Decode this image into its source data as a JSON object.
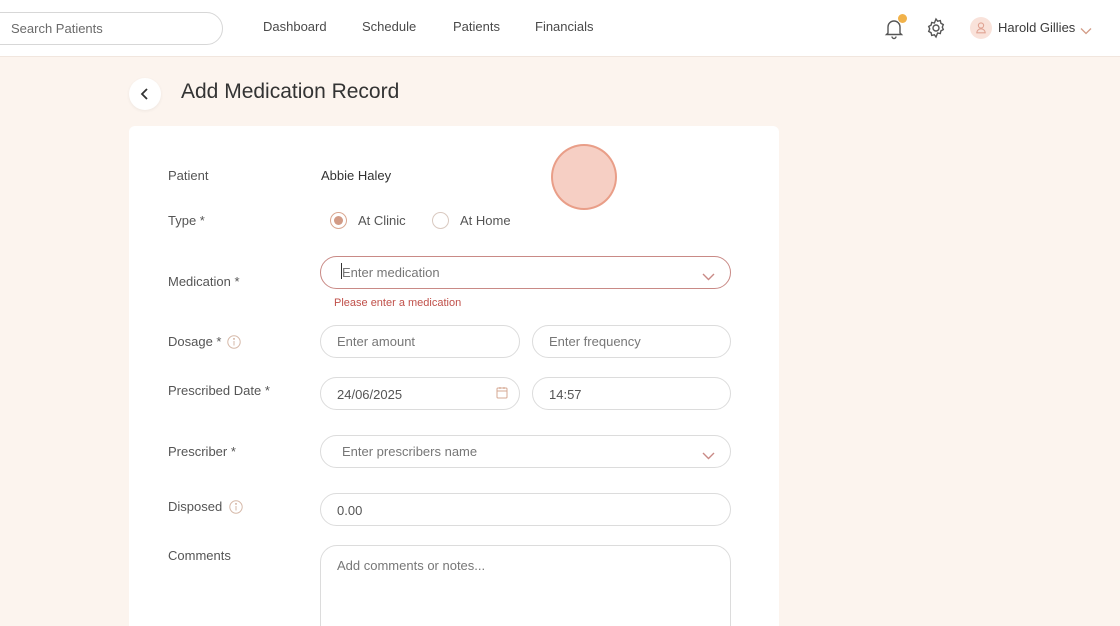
{
  "header": {
    "search_placeholder": "Search Patients",
    "nav": [
      "Dashboard",
      "Schedule",
      "Patients",
      "Financials"
    ],
    "user_name": "Harold Gillies",
    "notification_dot_color": "#f1b24a"
  },
  "page": {
    "title": "Add Medication Record"
  },
  "form": {
    "patient_label": "Patient",
    "patient_value": "Abbie Haley",
    "type_label": "Type *",
    "type_options": [
      "At Clinic",
      "At Home"
    ],
    "type_selected": "At Clinic",
    "medication_label": "Medication *",
    "medication_placeholder": "Enter medication",
    "medication_error": "Please enter a medication",
    "dosage_label": "Dosage *",
    "dosage_amount_placeholder": "Enter amount",
    "dosage_frequency_placeholder": "Enter frequency",
    "prescribed_date_label": "Prescribed Date *",
    "prescribed_date_value": "24/06/2025",
    "prescribed_time_value": "14:57",
    "prescriber_label": "Prescriber *",
    "prescriber_placeholder": "Enter prescribers name",
    "disposed_label": "Disposed",
    "disposed_value": "0.00",
    "comments_label": "Comments",
    "comments_placeholder": "Add comments or notes..."
  },
  "colors": {
    "accent": "#d29b86",
    "error": "#c0504a",
    "background": "#fcf4ee"
  }
}
